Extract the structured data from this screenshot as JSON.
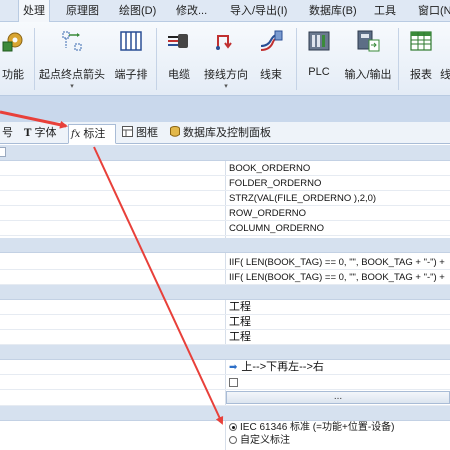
{
  "menubar": {
    "items": [
      {
        "label": "处理"
      },
      {
        "label": "原理图"
      },
      {
        "label": "绘图(D)"
      },
      {
        "label": "修改..."
      },
      {
        "label": "导入/导出(I)"
      },
      {
        "label": "数据库(B)"
      },
      {
        "label": "工具"
      },
      {
        "label": "窗口(N"
      }
    ]
  },
  "ribbon": {
    "buttons": [
      {
        "label": "功能",
        "icon": "function-gear-icon"
      },
      {
        "label": "起点终点箭头",
        "icon": "start-end-arrow-icon",
        "dropdown": true
      },
      {
        "label": "端子排",
        "icon": "terminal-strip-icon"
      },
      {
        "label": "电缆",
        "icon": "cable-icon"
      },
      {
        "label": "接线方向",
        "icon": "wiring-direction-icon",
        "dropdown": true
      },
      {
        "label": "线束",
        "icon": "harness-icon"
      },
      {
        "label": "PLC",
        "icon": "plc-icon"
      },
      {
        "label": "输入/输出",
        "icon": "io-icon"
      },
      {
        "label": "报表",
        "icon": "report-icon"
      },
      {
        "label": "线",
        "icon": "wire-icon"
      }
    ],
    "caret": "▾"
  },
  "tabs": [
    {
      "label": "号",
      "icon": ""
    },
    {
      "label": "字体",
      "icon": "font-icon"
    },
    {
      "label": "标注",
      "icon": "fx-icon",
      "active": true
    },
    {
      "label": "图框",
      "icon": "frame-icon"
    },
    {
      "label": "数据库及控制面板",
      "icon": "database-icon"
    }
  ],
  "grid": {
    "rows": [
      {
        "type": "section"
      },
      {
        "type": "value",
        "text": "BOOK_ORDERNO"
      },
      {
        "type": "value",
        "text": "FOLDER_ORDERNO"
      },
      {
        "type": "value",
        "text": "STRZ(VAL(FILE_ORDERNO ),2,0)"
      },
      {
        "type": "value",
        "text": "ROW_ORDERNO"
      },
      {
        "type": "value",
        "text": "COLUMN_ORDERNO"
      },
      {
        "type": "section"
      },
      {
        "type": "value",
        "text": "IIF( LEN(BOOK_TAG) == 0, \"\", BOOK_TAG + \"-\") +"
      },
      {
        "type": "value",
        "text": "IIF( LEN(BOOK_TAG) == 0, \"\", BOOK_TAG + \"-\") +"
      },
      {
        "type": "section"
      },
      {
        "type": "value",
        "text": "工程",
        "cjk": true
      },
      {
        "type": "value",
        "text": "工程",
        "cjk": true
      },
      {
        "type": "value",
        "text": "工程",
        "cjk": true
      },
      {
        "type": "section"
      },
      {
        "type": "arrow-value",
        "text": "上-->下再左-->右"
      },
      {
        "type": "checkbox",
        "checked": false
      },
      {
        "type": "button",
        "text": "..."
      },
      {
        "type": "section"
      },
      {
        "type": "radio-group"
      }
    ],
    "radio_options": [
      {
        "label": "IEC 61346 标准 (=功能+位置-设备)",
        "selected": true
      },
      {
        "label": "自定义标注",
        "selected": false
      }
    ]
  },
  "colors": {
    "menubar_bg": "#dfe8f4",
    "section_bg": "#d6e1ef",
    "annotation_arrow": "#e8403a"
  }
}
